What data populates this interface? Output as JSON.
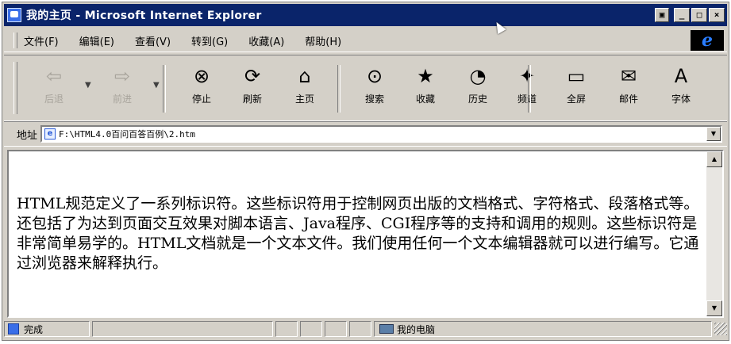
{
  "window": {
    "title": "我的主页 - Microsoft Internet Explorer",
    "buttons": {
      "minimize": "_",
      "maximize": "□",
      "close": "×",
      "extra": "▣"
    }
  },
  "menu": {
    "items": [
      "文件(F)",
      "编辑(E)",
      "查看(V)",
      "转到(G)",
      "收藏(A)",
      "帮助(H)"
    ],
    "logo": "e"
  },
  "toolbar": {
    "buttons": [
      {
        "label": "后退",
        "icon": "back-arrow-icon",
        "glyph": "⇦",
        "disabled": true
      },
      {
        "label": "前进",
        "icon": "forward-arrow-icon",
        "glyph": "⇨",
        "disabled": true
      },
      {
        "label": "停止",
        "icon": "stop-icon",
        "glyph": "⊗",
        "disabled": false
      },
      {
        "label": "刷新",
        "icon": "refresh-icon",
        "glyph": "⟳",
        "disabled": false
      },
      {
        "label": "主页",
        "icon": "home-icon",
        "glyph": "⌂",
        "disabled": false
      },
      {
        "label": "搜索",
        "icon": "search-icon",
        "glyph": "⊙",
        "disabled": false
      },
      {
        "label": "收藏",
        "icon": "favorites-icon",
        "glyph": "★",
        "disabled": false
      },
      {
        "label": "历史",
        "icon": "history-icon",
        "glyph": "◔",
        "disabled": false
      },
      {
        "label": "频道",
        "icon": "channels-icon",
        "glyph": "✦",
        "disabled": false
      },
      {
        "label": "全屏",
        "icon": "fullscreen-icon",
        "glyph": "▭",
        "disabled": false
      },
      {
        "label": "邮件",
        "icon": "mail-icon",
        "glyph": "✉",
        "disabled": false
      },
      {
        "label": "字体",
        "icon": "font-icon",
        "glyph": "A",
        "disabled": false
      }
    ]
  },
  "address": {
    "label": "地址",
    "value": "F:\\HTML4.0百问百答百例\\2.htm"
  },
  "content": {
    "text": "HTML规范定义了一系列标识符。这些标识符用于控制网页出版的文档格式、字符格式、段落格式等。还包括了为达到页面交互效果对脚本语言、Java程序、CGI程序等的支持和调用的规则。这些标识符是非常简单易学的。HTML文档就是一个文本文件。我们使用任何一个文本编辑器就可以进行编写。它通过浏览器来解释执行。"
  },
  "status": {
    "text": "完成",
    "zone": "我的电脑"
  }
}
